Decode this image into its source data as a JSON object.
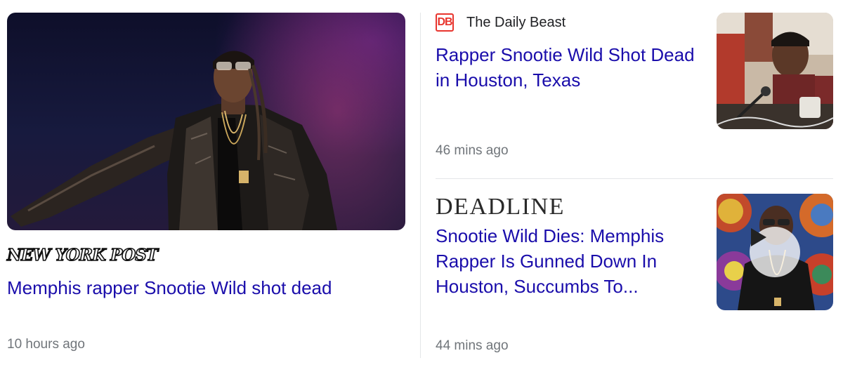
{
  "left_story": {
    "source": "NEW YORK POST",
    "image_icon": "photo-rapper-on-stage",
    "headline": "Memphis rapper Snootie Wild shot dead",
    "time": "10 hours ago"
  },
  "right_stories": [
    {
      "source_logo": "DB",
      "source": "The Daily Beast",
      "headline": "Rapper Snootie Wild Shot Dead in Houston, Texas",
      "time": "46 mins ago",
      "thumbnail_icon": "photo-rapper-with-microphone"
    },
    {
      "source": "DEADLINE",
      "headline": "Snootie Wild Dies: Memphis Rapper Is Gunned Down In Houston, Succumbs To...",
      "time": "44 mins ago",
      "thumbnail_icon": "video-thumbnail",
      "play_icon": "play-icon"
    }
  ],
  "colors": {
    "headline_link": "#1a0dab",
    "meta_text": "#70757a",
    "daily_beast_red": "#e8352e",
    "divider": "#e4e6e8"
  }
}
